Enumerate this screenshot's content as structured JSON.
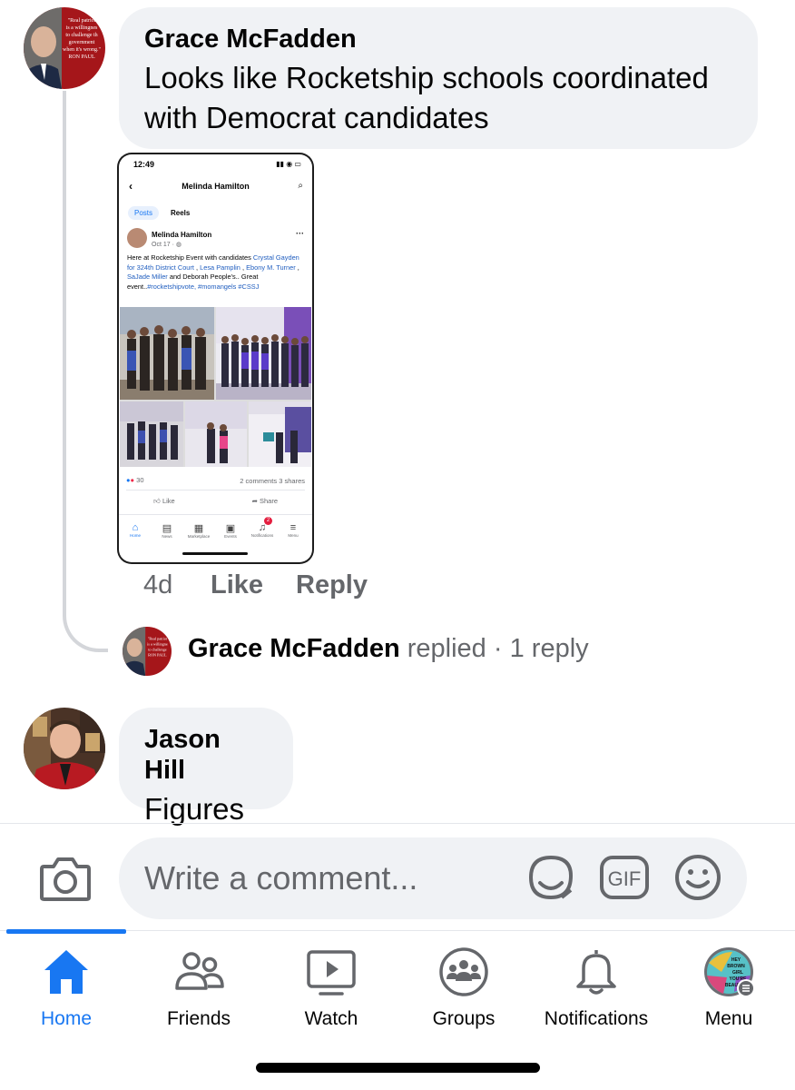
{
  "comments": [
    {
      "author": "Grace McFadden",
      "text_line1": "Looks like Rocketship schools coordinated",
      "text_line2": "with Democrat candidates",
      "avatar_quote": "\"Real patriotism is a willingness to challenge the government when it's wrong.\"",
      "avatar_attribution": "RON PAUL",
      "time": "4d",
      "like_label": "Like",
      "reply_label": "Reply",
      "reply_summary": {
        "author": "Grace McFadden",
        "verb": "replied",
        "separator": "·",
        "count": "1 reply"
      }
    },
    {
      "author": "Jason Hill",
      "text": "Figures"
    }
  ],
  "attached_screenshot": {
    "time": "12:49",
    "header_title": "Melinda Hamilton",
    "tabs": [
      "Posts",
      "Reels"
    ],
    "post_author": "Melinda Hamilton",
    "post_date": "Oct 17 ·",
    "post_text_1": "Here at Rocketship Event with candidates ",
    "post_link_1": "Crystal Gayden for 324th District Court",
    "post_sep_1": " , ",
    "post_link_2": "Lesa Pamplin",
    "post_sep_2": " , ",
    "post_link_3": "Ebony M. Turner",
    "post_sep_3": " , ",
    "post_link_4": "SaJade Miller",
    "post_text_2": " and Deborah People's.. Great event..",
    "post_tags": "#rocketshipvote, #momangels #CSSJ",
    "reaction_count": "30",
    "comment_share_counts": "2 comments  3 shares",
    "like_label": "Like",
    "share_label": "Share",
    "nav": [
      "Home",
      "News",
      "Marketplace",
      "Events",
      "Notifications",
      "Menu"
    ],
    "notification_badge": "2"
  },
  "composer": {
    "placeholder": "Write a comment...",
    "gif_label": "GIF",
    "icons": [
      "camera-icon",
      "sticker-icon",
      "gif-icon",
      "emoji-icon"
    ]
  },
  "bottom_nav": {
    "items": [
      {
        "label": "Home",
        "icon": "home-icon",
        "active": true
      },
      {
        "label": "Friends",
        "icon": "friends-icon"
      },
      {
        "label": "Watch",
        "icon": "watch-icon"
      },
      {
        "label": "Groups",
        "icon": "groups-icon"
      },
      {
        "label": "Notifications",
        "icon": "bell-icon"
      },
      {
        "label": "Menu",
        "icon": "menu-avatar-icon"
      }
    ],
    "menu_avatar_text": "HEY BROWN GIRL YOU'RE BEAUTIFUL"
  },
  "colors": {
    "accent": "#1877f2",
    "bubble": "#f0f2f5",
    "secondary_text": "#65676b",
    "link": "#1f5dbf"
  }
}
